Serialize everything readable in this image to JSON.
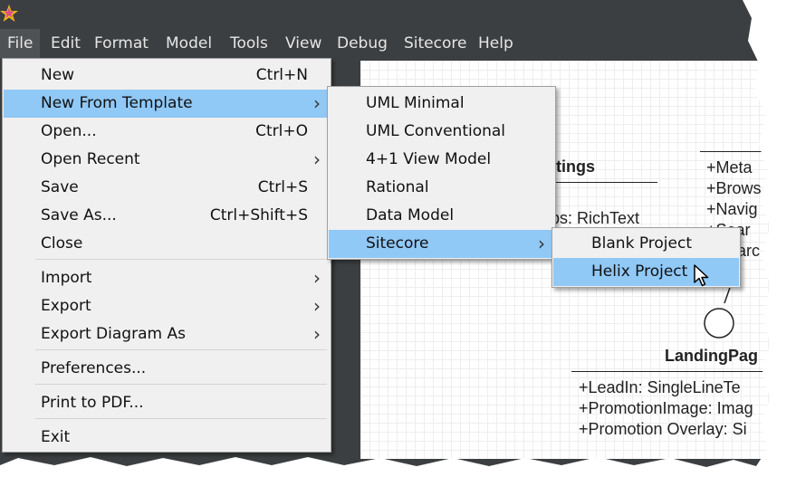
{
  "menubar": [
    "File",
    "Edit",
    "Format",
    "Model",
    "Tools",
    "View",
    "Debug",
    "Sitecore",
    "Help"
  ],
  "file_menu": [
    {
      "label": "New",
      "shortcut": "Ctrl+N"
    },
    {
      "label": "New From Template",
      "shortcut": "",
      "submenu": true,
      "highlighted": true
    },
    {
      "label": "Open...",
      "shortcut": "Ctrl+O"
    },
    {
      "label": "Open Recent",
      "shortcut": "",
      "submenu": true
    },
    {
      "label": "Save",
      "shortcut": "Ctrl+S"
    },
    {
      "label": "Save As...",
      "shortcut": "Ctrl+Shift+S"
    },
    {
      "label": "Close",
      "shortcut": ""
    },
    {
      "label": "Import",
      "shortcut": "",
      "submenu": true
    },
    {
      "label": "Export",
      "shortcut": "",
      "submenu": true
    },
    {
      "label": "Export Diagram As",
      "shortcut": "",
      "submenu": true
    },
    {
      "label": "Preferences...",
      "shortcut": ""
    },
    {
      "label": "Print to PDF...",
      "shortcut": ""
    },
    {
      "label": "Exit",
      "shortcut": ""
    }
  ],
  "template_menu": [
    {
      "label": "UML Minimal"
    },
    {
      "label": "UML Conventional"
    },
    {
      "label": "4+1 View Model"
    },
    {
      "label": "Rational"
    },
    {
      "label": "Data Model"
    },
    {
      "label": "Sitecore",
      "submenu": true,
      "highlighted": true
    }
  ],
  "sitecore_menu": [
    {
      "label": "Blank Project"
    },
    {
      "label": "Helix Project",
      "highlighted": true
    }
  ],
  "diagram": {
    "class1_title_partial": "ttings",
    "class1_attr_partial": "ps: RichText",
    "class2_attrs_partial": [
      "+Meta",
      "+Brows",
      "+Navig",
      "+Sear",
      "earc"
    ],
    "landing_title": "LandingPag",
    "landing_attrs": [
      "+LeadIn: SingleLineTe",
      "+PromotionImage: Imag",
      "+Promotion Overlay: Si"
    ]
  },
  "colors": {
    "chrome": "#3c3f41",
    "menu_bg": "#f0f0f0",
    "highlight": "#90c8f6"
  }
}
